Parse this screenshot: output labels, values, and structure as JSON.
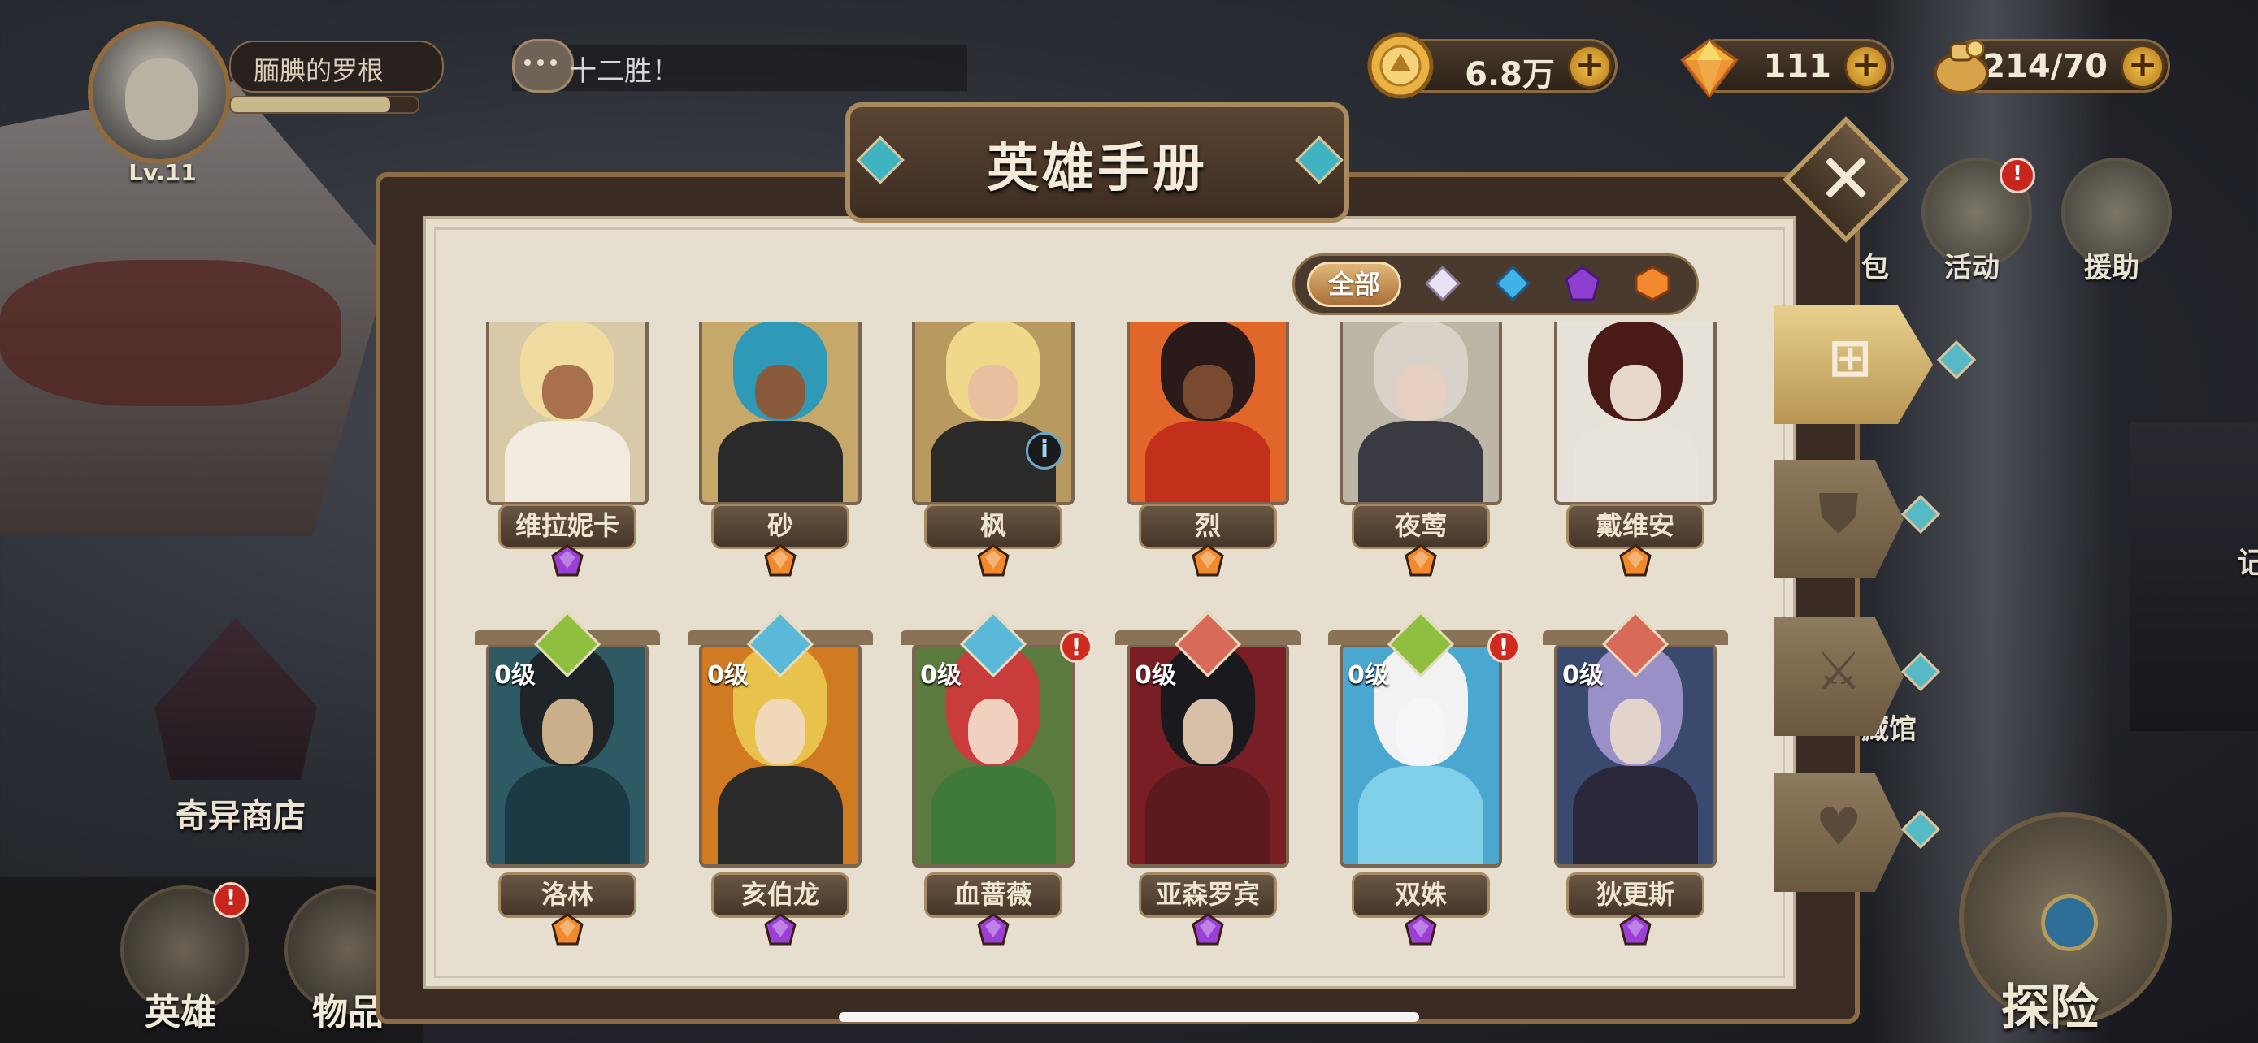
{
  "player": {
    "name": "腼腆的罗根",
    "level": "Lv.11",
    "exp_fraction": 0.85
  },
  "chat": {
    "text": "十二胜！"
  },
  "resources": [
    {
      "name": "gold",
      "icon": "gold-coin-icon",
      "value": "6.8万",
      "color": "#e9b243"
    },
    {
      "name": "diamond",
      "icon": "diamond-icon",
      "value": "111",
      "color": "#f1b33a"
    },
    {
      "name": "stamina",
      "icon": "treasure-bag-icon",
      "value": "214/70",
      "color": "#d6a24a"
    }
  ],
  "panel": {
    "title": "英雄手册",
    "filter_all": "全部"
  },
  "filter_gems": [
    {
      "name": "filter-white-gem-icon",
      "color": "#e9e2f2"
    },
    {
      "name": "filter-blue-gem-icon",
      "color": "#3fb2e6"
    },
    {
      "name": "filter-purple-gem-icon",
      "color": "#8f3fd0"
    },
    {
      "name": "filter-orange-gem-icon",
      "color": "#f08a2c"
    }
  ],
  "side_menu": {
    "bag": "包",
    "activity": "活动",
    "support": "援助",
    "collection": "藏馆",
    "partial_right": "记",
    "activity_alert": "!"
  },
  "bottom": {
    "shop": "奇异商店",
    "hero": "英雄",
    "items": "物品",
    "explore": "探险",
    "hero_alert": "!"
  },
  "heroes_row1": [
    {
      "name": "维拉妮卡",
      "rarity_color": "#9b3fd6",
      "hair": "#f0dca0",
      "skin": "#a8704c",
      "cloth": "#f2ece0",
      "bg": "#d8c9a8"
    },
    {
      "name": "砂",
      "rarity_color": "#f08a2c",
      "hair": "#2f9ab8",
      "skin": "#8a5a3c",
      "cloth": "#2a2a2a",
      "bg": "#c6a86a"
    },
    {
      "name": "枫",
      "rarity_color": "#f08a2c",
      "hair": "#f0d88a",
      "skin": "#e8c0a0",
      "cloth": "#2c2a28",
      "bg": "#b89a60",
      "info": "i"
    },
    {
      "name": "烈",
      "rarity_color": "#f08a2c",
      "hair": "#2a1a1a",
      "skin": "#7a4a30",
      "cloth": "#c2301c",
      "bg": "#e0662a"
    },
    {
      "name": "夜莺",
      "rarity_color": "#f08a2c",
      "hair": "#d8d2c8",
      "skin": "#e8d0c0",
      "cloth": "#3a3a42",
      "bg": "#bdb5a6"
    },
    {
      "name": "戴维安",
      "rarity_color": "#f08a2c",
      "hair": "#4a1a16",
      "skin": "#e6d8cc",
      "cloth": "#e8e4dc",
      "bg": "#e6e2da"
    }
  ],
  "heroes_row2": [
    {
      "name": "洛林",
      "level": "0级",
      "rarity_color": "#f08a2c",
      "type_color": "#8fbf3e",
      "hair": "#1e2428",
      "skin": "#c9b08a",
      "cloth": "#1c3a44",
      "bg": "#2e5a66"
    },
    {
      "name": "亥伯龙",
      "level": "0级",
      "rarity_color": "#9b3fd6",
      "type_color": "#5ab8d8",
      "hair": "#e8c24a",
      "skin": "#f0d8b8",
      "cloth": "#2a2a2a",
      "bg": "#d07a22"
    },
    {
      "name": "血蔷薇",
      "level": "0级",
      "rarity_color": "#9b3fd6",
      "type_color": "#5ab8d8",
      "hair": "#c83c3c",
      "skin": "#f2d0c0",
      "cloth": "#3f7a3a",
      "bg": "#5a7a3e",
      "alert": "!"
    },
    {
      "name": "亚森罗宾",
      "level": "0级",
      "rarity_color": "#9b3fd6",
      "type_color": "#d86a5a",
      "hair": "#1a1a1e",
      "skin": "#d8c0a8",
      "cloth": "#5a1a1e",
      "bg": "#7a1e26"
    },
    {
      "name": "双姝",
      "level": "0级",
      "rarity_color": "#9b3fd6",
      "type_color": "#8fbf3e",
      "hair": "#f2f2f2",
      "skin": "#f4f6f8",
      "cloth": "#7fd0e8",
      "bg": "#4aa8d0",
      "alert": "!"
    },
    {
      "name": "狄更斯",
      "level": "0级",
      "rarity_color": "#9b3fd6",
      "type_color": "#d86a5a",
      "hair": "#9a90c8",
      "skin": "#e2d4cc",
      "cloth": "#2a2838",
      "bg": "#3a4a6e"
    }
  ]
}
